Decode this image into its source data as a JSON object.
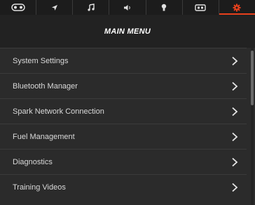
{
  "tabs": [
    {
      "icon": "gauge-cluster-icon"
    },
    {
      "icon": "navigation-arrow-icon"
    },
    {
      "icon": "music-note-icon"
    },
    {
      "icon": "volume-speaker-icon"
    },
    {
      "icon": "light-bulb-icon"
    },
    {
      "icon": "battery-icon"
    },
    {
      "icon": "settings-gear-icon",
      "active": true
    }
  ],
  "title": "MAIN MENU",
  "menu": {
    "items": [
      {
        "label": "System Settings"
      },
      {
        "label": "Bluetooth Manager"
      },
      {
        "label": "Spark Network Connection"
      },
      {
        "label": "Fuel Management"
      },
      {
        "label": "Diagnostics"
      },
      {
        "label": "Training Videos"
      }
    ]
  },
  "colors": {
    "accent": "#e8401c",
    "background": "#2b2b2b",
    "header": "#222222",
    "text": "#d9d9d9"
  }
}
